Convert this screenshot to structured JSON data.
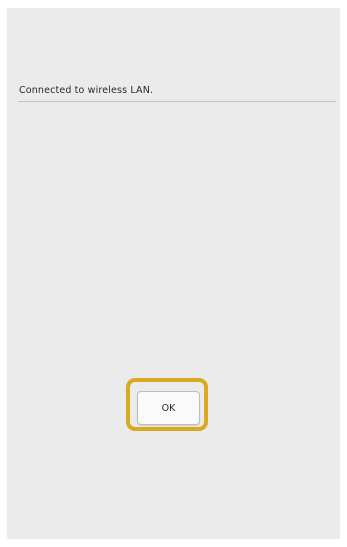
{
  "dialog": {
    "message": "Connected to wireless LAN.",
    "ok_label": "OK"
  },
  "colors": {
    "screen_background": "#ebebeb",
    "highlight": "#d9a91f",
    "button_background": "#fafafa"
  }
}
